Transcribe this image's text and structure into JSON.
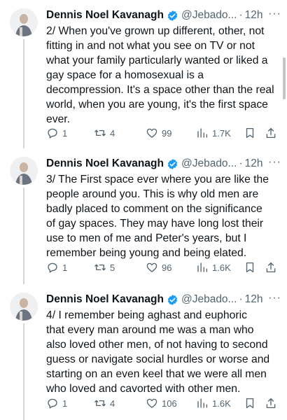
{
  "tweets": [
    {
      "name": "Dennis Noel Kavanagh",
      "handle": "@Jebado...",
      "dot": "·",
      "time": "12h",
      "text": "2/ When you've grown up different, other, not\nfitting in and not what you see on TV or not\nwhat your family particularly wanted or liked a\ngay space for a homosexual is a\ndecompression. It's a space other than the real\nworld, when you are young, it's the first space\never.",
      "replies": "1",
      "retweets": "4",
      "likes": "99",
      "views": "1.7K"
    },
    {
      "name": "Dennis Noel Kavanagh",
      "handle": "@Jebado...",
      "dot": "·",
      "time": "12h",
      "text": "3/ The First space ever where you are like the\npeople around you. This is why old men are\nbadly placed to comment on the significance\nof gay spaces. They may have long lost their\nuse to men of me and Peter's years, but I\nremember being young and being elated.",
      "replies": "1",
      "retweets": "5",
      "likes": "96",
      "views": "1.6K"
    },
    {
      "name": "Dennis Noel Kavanagh",
      "handle": "@Jebado...",
      "dot": "·",
      "time": "12h",
      "text": "4/ I remember being aghast and euphoric\nthat every man around me was a man who\nalso loved other men, of not having to second\nguess or navigate social hurdles or worse and\nstarting on an even keel that we were all men\nwho loved and cavorted with other men.",
      "replies": "1",
      "retweets": "4",
      "likes": "106",
      "views": "1.6K"
    }
  ],
  "icons": {
    "verified": "verified-badge-icon",
    "reply": "reply-icon",
    "retweet": "retweet-icon",
    "like": "heart-icon",
    "views": "views-icon",
    "bookmark": "bookmark-icon",
    "share": "share-icon",
    "more": "more-icon"
  },
  "colors": {
    "verified": "#1d9bf0",
    "text": "#0f1419",
    "muted": "#536471",
    "thread_line": "#cfd9de"
  }
}
